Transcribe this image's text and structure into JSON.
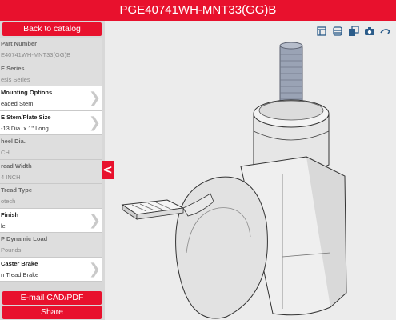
{
  "header": {
    "title": "PGE40741WH-MNT33(GG)B"
  },
  "sidebar": {
    "back_label": "Back to catalog",
    "options": [
      {
        "label": "Part Number",
        "value": "E40741WH-MNT33(GG)B",
        "editable": false
      },
      {
        "label": "E Series",
        "value": "esis Series",
        "editable": false
      },
      {
        "label": "Mounting Options",
        "value": "eaded Stem",
        "editable": true
      },
      {
        "label": "E Stem/Plate Size",
        "value": "-13 Dia. x 1\" Long",
        "editable": true
      },
      {
        "label": "heel Dia.",
        "value": "CH",
        "editable": false
      },
      {
        "label": "read Width",
        "value": "4 INCH",
        "editable": false
      },
      {
        "label": "Tread Type",
        "value": "otech",
        "editable": false
      },
      {
        "label": "Finish",
        "value": "le",
        "editable": true
      },
      {
        "label": "P Dynamic Load",
        "value": " Pounds",
        "editable": false
      },
      {
        "label": "Caster Brake",
        "value": "n Tread Brake",
        "editable": true
      }
    ],
    "email_label": "E-mail CAD/PDF",
    "share_label": "Share"
  },
  "collapse_glyph": "<",
  "colors": {
    "accent": "#e8112d",
    "toolbar_icon": "#2b5c8a"
  },
  "toolbar": {
    "icons": [
      "dimensions-icon",
      "layers-icon",
      "view-cube-icon",
      "camera-icon",
      "share-link-icon"
    ]
  }
}
